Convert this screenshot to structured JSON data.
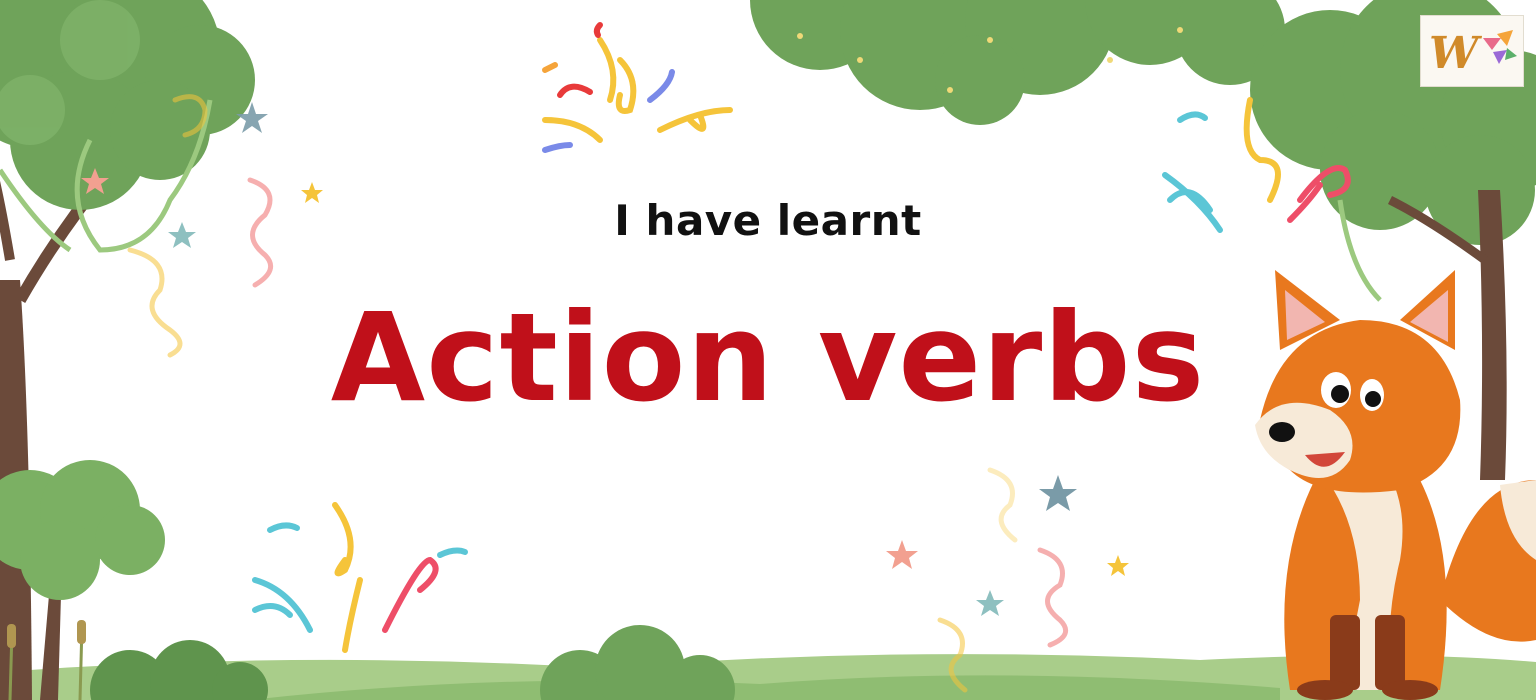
{
  "slide": {
    "subtitle": "I have learnt",
    "title": "Action verbs"
  },
  "colors": {
    "title": "#c0101a",
    "subtitle": "#111111",
    "foliage": "#6fa35a",
    "fox_orange": "#e8781e",
    "grass": "#a9cd8a"
  },
  "icons": [
    "logo-w-icon",
    "fox-mascot-icon",
    "confetti-icon",
    "star-icon"
  ]
}
